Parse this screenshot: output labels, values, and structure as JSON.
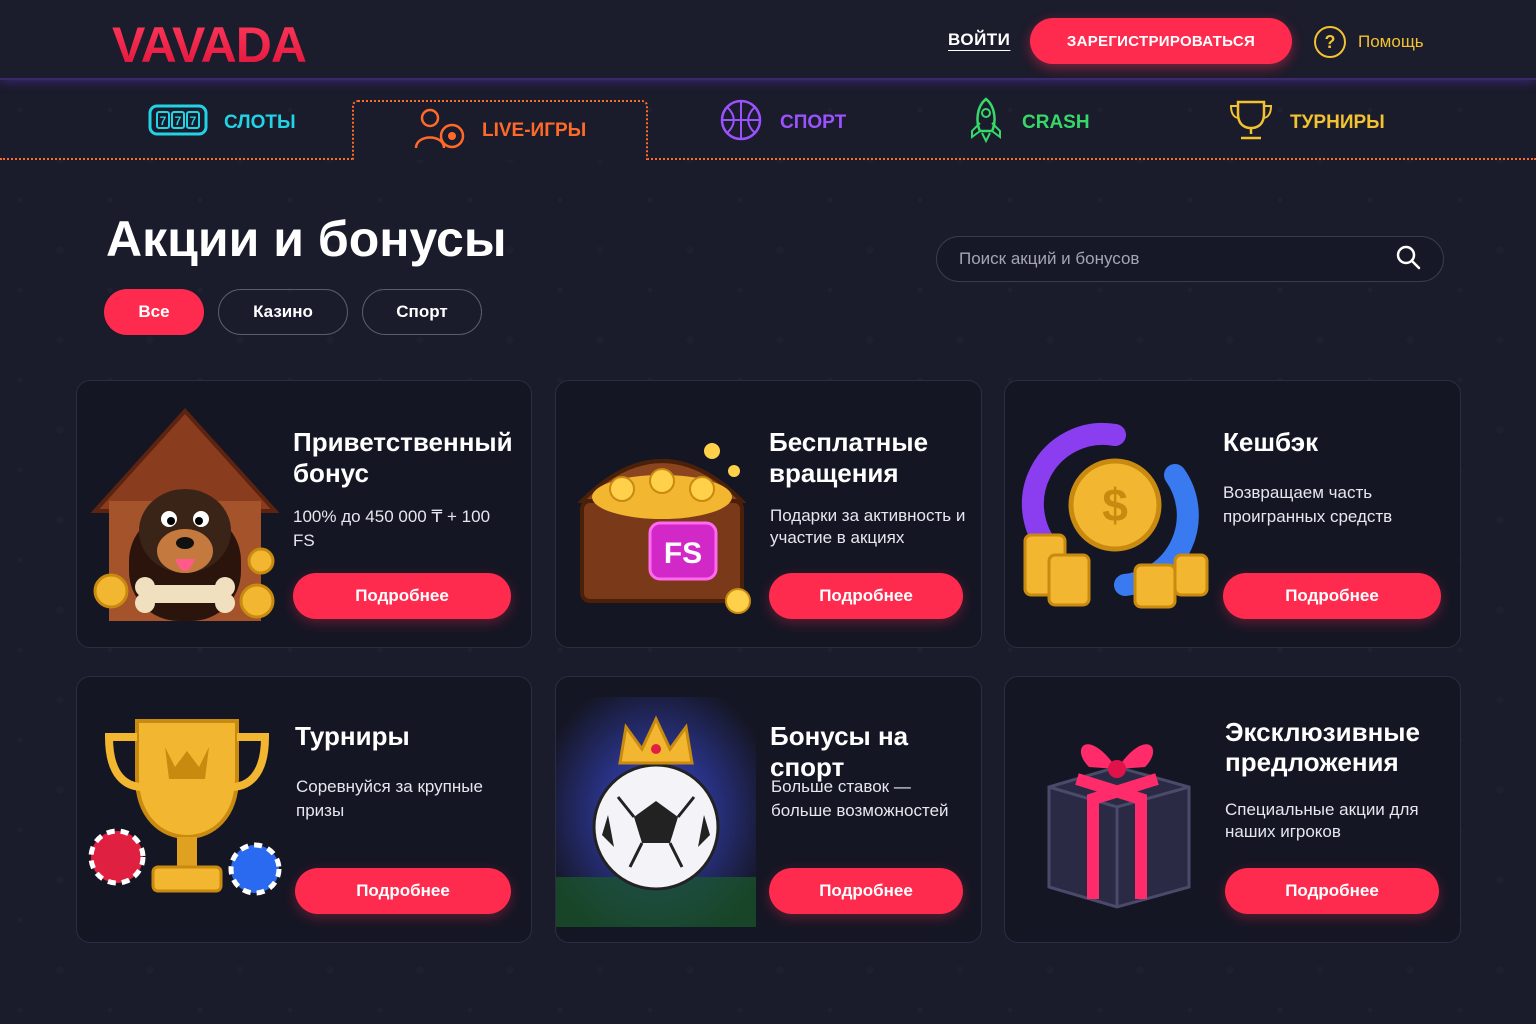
{
  "header": {
    "logo_text": "VAVADA",
    "login_label": "ВОЙТИ",
    "register_label": "ЗАРЕГИСТРИРОВАТЬСЯ",
    "help_label": "Помощь"
  },
  "nav": {
    "items": [
      {
        "label": "СЛОТЫ",
        "icon": "slot-machine-icon",
        "color": "#22d3e6"
      },
      {
        "label": "LIVE-ИГРЫ",
        "icon": "live-dealer-icon",
        "color": "#ff6a2a",
        "active": true
      },
      {
        "label": "СПОРТ",
        "icon": "basketball-icon",
        "color": "#9a52ff"
      },
      {
        "label": "CRASH",
        "icon": "rocket-icon",
        "color": "#36d86a"
      },
      {
        "label": "ТУРНИРЫ",
        "icon": "trophy-icon",
        "color": "#f2c230"
      }
    ]
  },
  "page": {
    "title": "Акции и бонусы",
    "filters": [
      "Все",
      "Казино",
      "Спорт"
    ],
    "active_filter": "Все",
    "search_placeholder": "Поиск акций и бонусов"
  },
  "cards": [
    {
      "title": "Приветственный бонус",
      "desc": "100% до 450 000 ₸ + 100 FS",
      "button": "Подробнее",
      "art": "dog-in-kennel-with-coins"
    },
    {
      "title": "Бесплатные вращения",
      "desc": "Подарки за активность и участие в акциях",
      "button": "Подробнее",
      "art": "treasure-chest-fs",
      "badge": "FS"
    },
    {
      "title": "Кешбэк",
      "desc": "Возвращаем часть проигранных средств",
      "button": "Подробнее",
      "art": "cashback-coin-arrows",
      "badge": "$"
    },
    {
      "title": "Турниры",
      "desc": "Соревнуйся за крупные призы",
      "button": "Подробнее",
      "art": "golden-trophy-with-chips"
    },
    {
      "title": "Бонусы на спорт",
      "desc": "Больше ставок — больше возможностей",
      "button": "Подробнее",
      "art": "soccer-ball-with-crown"
    },
    {
      "title": "Эксклюзивные предложения",
      "desc": "Специальные акции для наших игроков",
      "button": "Подробнее",
      "art": "gift-box"
    }
  ],
  "colors": {
    "background": "#1a1b2b",
    "card": "#151624",
    "accent": "#ff2b4f",
    "help": "#f2c230"
  }
}
